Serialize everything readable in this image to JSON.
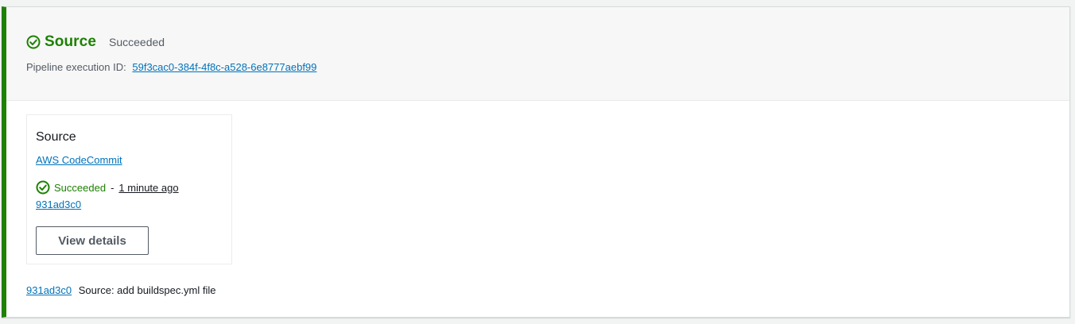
{
  "stage": {
    "name": "Source",
    "status": "Succeeded",
    "status_icon": "check-circle-icon",
    "accent_color": "#1d8102",
    "execution_label": "Pipeline execution ID:",
    "execution_id": "59f3cac0-384f-4f8c-a528-6e8777aebf99"
  },
  "action": {
    "name": "Source",
    "provider": "AWS CodeCommit",
    "status": "Succeeded",
    "status_icon": "check-circle-icon",
    "separator": "-",
    "time_ago": "1 minute ago",
    "commit_id": "931ad3c0",
    "view_details_label": "View details"
  },
  "commit": {
    "id": "931ad3c0",
    "message": "Source: add buildspec.yml file"
  }
}
